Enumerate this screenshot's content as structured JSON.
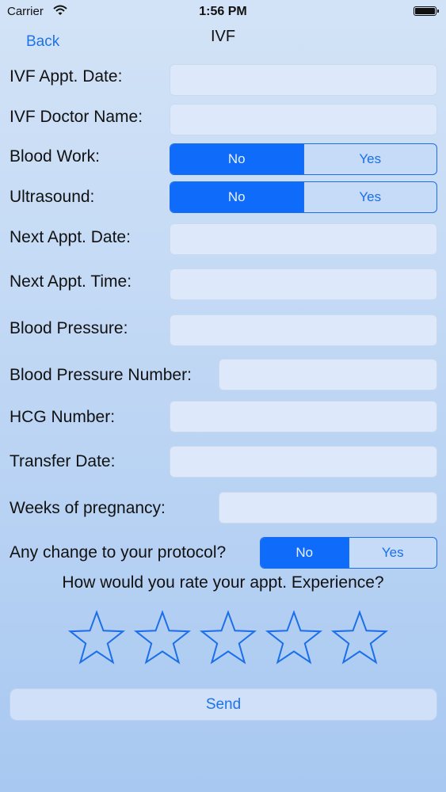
{
  "status_bar": {
    "carrier": "Carrier",
    "time": "1:56 PM"
  },
  "nav": {
    "back_label": "Back",
    "title": "IVF"
  },
  "form": {
    "appt_date_label": "IVF Appt. Date:",
    "doctor_label": "IVF Doctor Name:",
    "blood_work_label": "Blood Work:",
    "ultrasound_label": "Ultrasound:",
    "next_date_label": "Next Appt. Date:",
    "next_time_label": "Next Appt. Time:",
    "bp_label": "Blood Pressure:",
    "bp_number_label": "Blood Pressure Number:",
    "hcg_label": "HCG Number:",
    "transfer_label": "Transfer Date:",
    "weeks_label": "Weeks of pregnancy:",
    "protocol_label": "Any change to your protocol?",
    "option_no": "No",
    "option_yes": "Yes",
    "blood_work_selected": "No",
    "ultrasound_selected": "No",
    "protocol_selected": "No"
  },
  "rating": {
    "question": "How would you rate your appt. Experience?",
    "value": 0,
    "max": 5
  },
  "send_label": "Send",
  "colors": {
    "accent": "#1c6fe8",
    "selected": "#0f6bfa"
  }
}
